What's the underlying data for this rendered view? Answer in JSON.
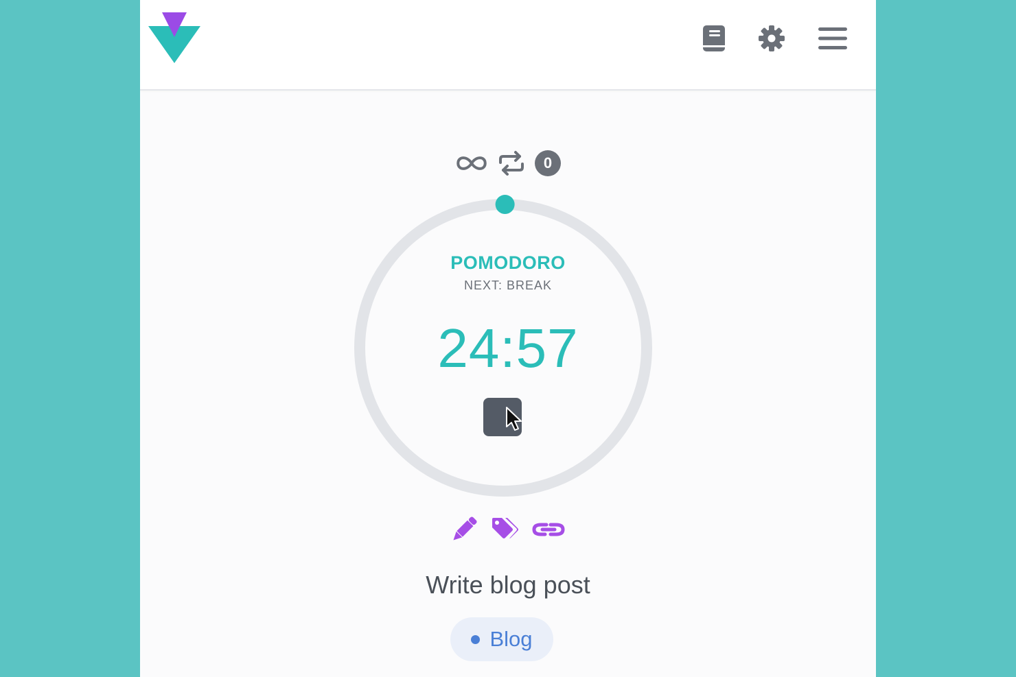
{
  "colors": {
    "backdrop": "#5bc4c3",
    "accent": "#2bbdb8",
    "action_purple": "#a64ee6",
    "icon_gray": "#6b7078",
    "ring_track": "#e2e4e8",
    "tag_blue": "#4a7fd6"
  },
  "header": {
    "logo_icon": "triangle-logo-icon",
    "buttons": [
      {
        "icon": "book-icon"
      },
      {
        "icon": "gear-icon"
      },
      {
        "icon": "hamburger-menu-icon"
      }
    ]
  },
  "timer": {
    "mode_icons": [
      "infinity-icon",
      "repeat-icon"
    ],
    "session_count": "0",
    "mode": "POMODORO",
    "next": "NEXT: BREAK",
    "time": "24:57",
    "progress_fraction": 0.002,
    "control_icon": "stop-icon"
  },
  "actions": [
    {
      "icon": "pencil-icon"
    },
    {
      "icon": "tags-icon"
    },
    {
      "icon": "link-icon"
    }
  ],
  "task": {
    "title": "Write blog post",
    "tag": "Blog"
  }
}
